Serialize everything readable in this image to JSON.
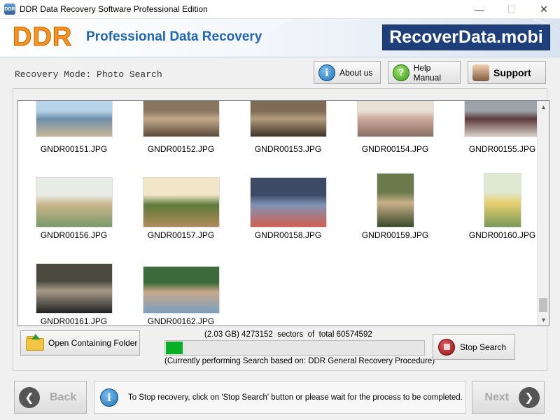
{
  "window": {
    "title": "DDR Data Recovery Software Professional Edition",
    "app_icon_text": "DDR",
    "minimize": "—",
    "maximize": "☐",
    "close": "✕"
  },
  "banner": {
    "logo": "DDR",
    "tagline": "Professional Data Recovery",
    "site": "RecoverData.mobi"
  },
  "mode": {
    "label": "Recovery Mode: Photo Search"
  },
  "toolbar": {
    "about": "About us",
    "help": "Help Manual",
    "support": "Support"
  },
  "gallery": {
    "files": [
      {
        "name": "GNDR00151.JPG",
        "colors": [
          "#b7d3ea",
          "#6d8fa8",
          "#c8b79a"
        ]
      },
      {
        "name": "GNDR00152.JPG",
        "colors": [
          "#8a7560",
          "#c4a98b",
          "#5c4a3a"
        ]
      },
      {
        "name": "GNDR00153.JPG",
        "colors": [
          "#7e6a55",
          "#b39a7c",
          "#3f3328"
        ]
      },
      {
        "name": "GNDR00154.JPG",
        "colors": [
          "#e9e0d6",
          "#caa89a",
          "#8b6f64"
        ]
      },
      {
        "name": "GNDR00155.JPG",
        "colors": [
          "#9aa3a8",
          "#5c3b3b",
          "#d8d0c8"
        ]
      },
      {
        "name": "GNDR00156.JPG",
        "colors": [
          "#e8ece6",
          "#c9b48a",
          "#7a9a6a"
        ]
      },
      {
        "name": "GNDR00157.JPG",
        "colors": [
          "#f2e6c8",
          "#5e7a3a",
          "#b08a5a"
        ]
      },
      {
        "name": "GNDR00158.JPG",
        "colors": [
          "#3c4a66",
          "#8093b5",
          "#d06050"
        ]
      },
      {
        "name": "GNDR00159.JPG",
        "colors": [
          "#6b7a4a",
          "#c9b08a",
          "#3a4a2a"
        ]
      },
      {
        "name": "GNDR00160.JPG",
        "colors": [
          "#dfe8d0",
          "#e8d070",
          "#7a9a5a"
        ]
      },
      {
        "name": "GNDR00161.JPG",
        "colors": [
          "#4a4a40",
          "#a89a88",
          "#222222"
        ]
      },
      {
        "name": "GNDR00162.JPG",
        "colors": [
          "#3d6a3a",
          "#c9a88a",
          "#7aa0c0"
        ]
      }
    ]
  },
  "status": {
    "open_folder": "Open Containing Folder",
    "sectors": "(2.03 GB) 4273152  sectors  of  total 60574592",
    "progress_fraction": 0.066,
    "progress_note": "(Currently performing Search based on:  DDR General Recovery Procedure)",
    "stop": "Stop Search"
  },
  "footer": {
    "back": "Back",
    "next": "Next",
    "info": "To Stop recovery, click on 'Stop Search' button or please wait for the process to be completed."
  }
}
